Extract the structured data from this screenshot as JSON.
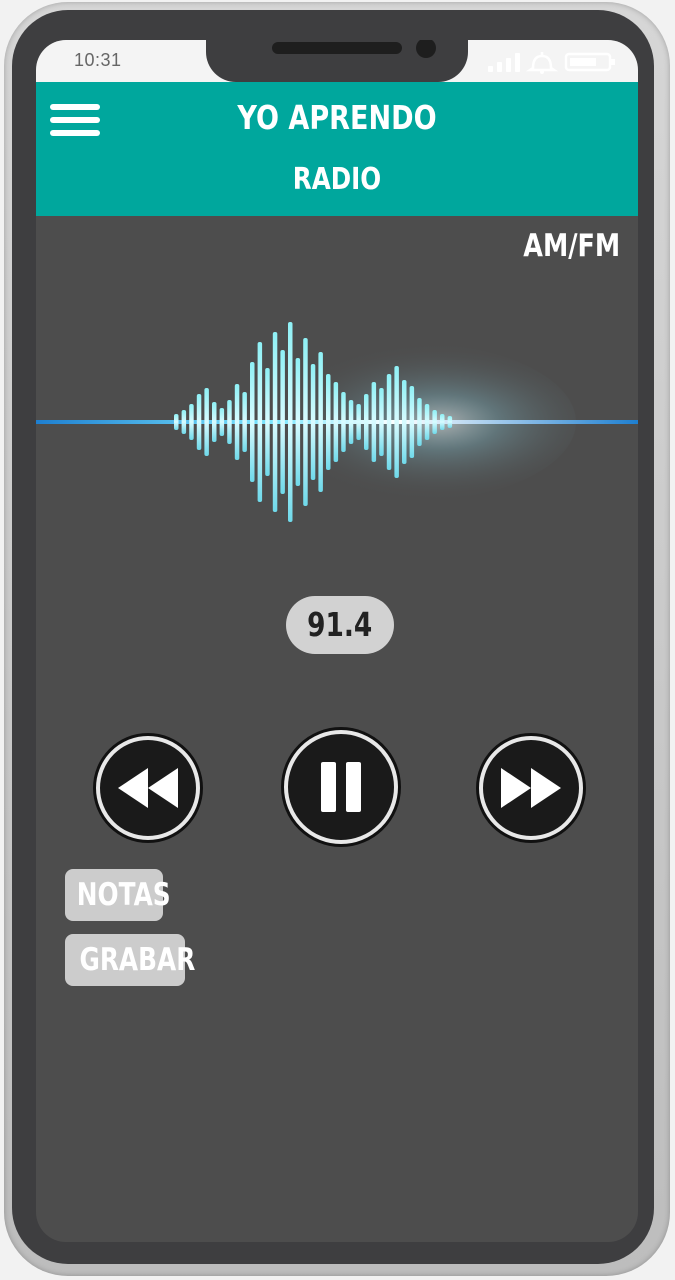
{
  "status_bar": {
    "time": "10:31"
  },
  "header": {
    "title_line1": "YO APRENDO",
    "title_line2": "RADIO"
  },
  "band_toggle": "AM/FM",
  "player": {
    "frequency": "91.4"
  },
  "buttons": {
    "notes": "NOTAS",
    "record": "GRABAR"
  },
  "colors": {
    "header": "#00a79d",
    "screen": "#4d4d4d",
    "wave": "#7de3f0"
  },
  "icons": [
    "menu-icon",
    "signal-icon",
    "bell-icon",
    "battery-icon",
    "rewind-icon",
    "pause-icon",
    "fast-forward-icon"
  ]
}
